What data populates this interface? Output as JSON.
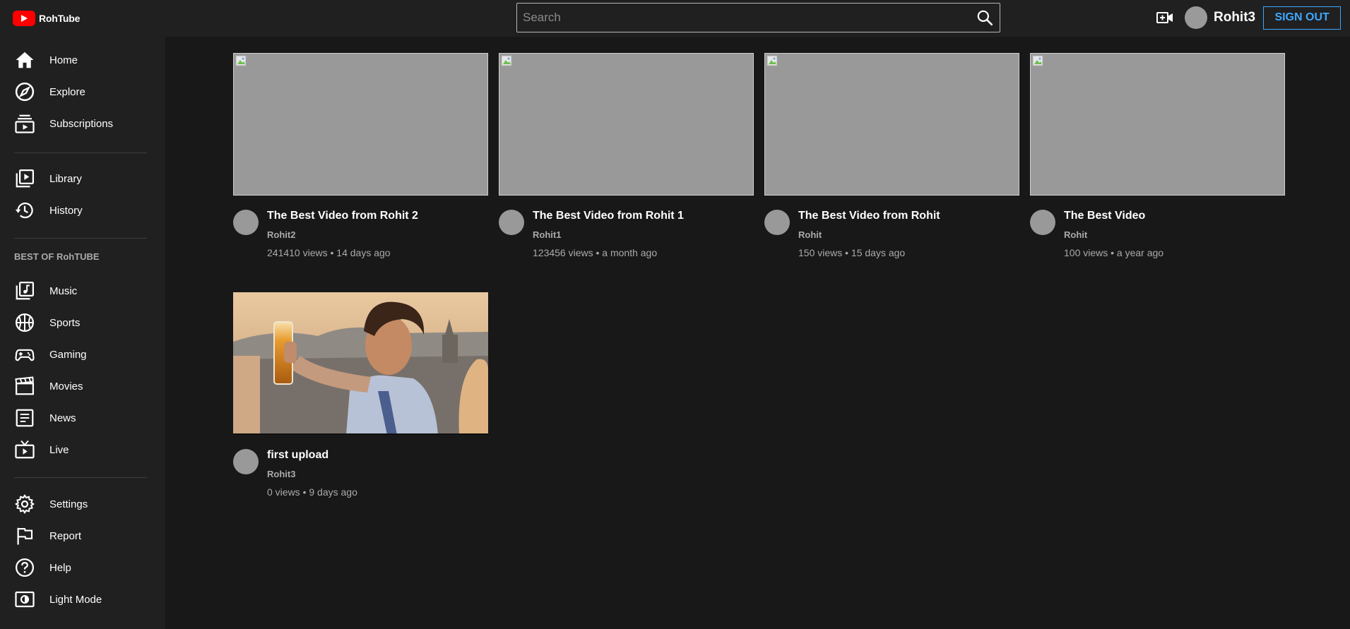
{
  "header": {
    "brand": "RohTube",
    "search_placeholder": "Search",
    "username": "Rohit3",
    "signout_label": "SIGN OUT"
  },
  "sidebar": {
    "primary": [
      {
        "label": "Home",
        "icon": "home-icon"
      },
      {
        "label": "Explore",
        "icon": "compass-icon"
      },
      {
        "label": "Subscriptions",
        "icon": "subscriptions-icon"
      }
    ],
    "secondary": [
      {
        "label": "Library",
        "icon": "library-icon"
      },
      {
        "label": "History",
        "icon": "history-icon"
      }
    ],
    "section_title": "BEST OF RohTUBE",
    "best_of": [
      {
        "label": "Music",
        "icon": "music-icon"
      },
      {
        "label": "Sports",
        "icon": "sports-icon"
      },
      {
        "label": "Gaming",
        "icon": "gaming-icon"
      },
      {
        "label": "Movies",
        "icon": "movies-icon"
      },
      {
        "label": "News",
        "icon": "news-icon"
      },
      {
        "label": "Live",
        "icon": "live-icon"
      }
    ],
    "footer": [
      {
        "label": "Settings",
        "icon": "gear-icon"
      },
      {
        "label": "Report",
        "icon": "flag-icon"
      },
      {
        "label": "Help",
        "icon": "help-icon"
      },
      {
        "label": "Light Mode",
        "icon": "light-mode-icon"
      }
    ]
  },
  "videos": [
    {
      "title": "The Best Video from Rohit 2",
      "channel": "Rohit2",
      "stats": "241410 views • 14 days ago",
      "thumbnail": "broken-image"
    },
    {
      "title": "The Best Video from Rohit 1",
      "channel": "Rohit1",
      "stats": "123456 views • a month ago",
      "thumbnail": "broken-image"
    },
    {
      "title": "The Best Video from Rohit",
      "channel": "Rohit",
      "stats": "150 views • 15 days ago",
      "thumbnail": "broken-image"
    },
    {
      "title": "The Best Video",
      "channel": "Rohit",
      "stats": "100 views • a year ago",
      "thumbnail": "broken-image"
    },
    {
      "title": "first upload",
      "channel": "Rohit3",
      "stats": "0 views • 9 days ago",
      "thumbnail": "photo-man-with-beer-glass"
    }
  ],
  "colors": {
    "accent": "#3ea6ff",
    "brand": "#ff0000",
    "background": "#181818",
    "surface": "#202020"
  }
}
